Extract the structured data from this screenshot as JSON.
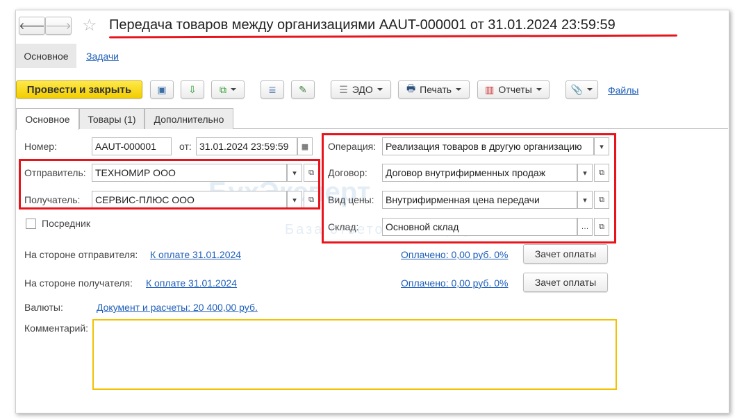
{
  "title": "Передача товаров между организациями AAUT-000001 от 31.01.2024 23:59:59",
  "nav_tabs": [
    "Основное",
    "Задачи"
  ],
  "toolbar": {
    "post_close": "Провести и закрыть",
    "edo": "ЭДО",
    "print": "Печать",
    "reports": "Отчеты",
    "files": "Файлы"
  },
  "tabs": [
    "Основное",
    "Товары (1)",
    "Дополнительно"
  ],
  "form": {
    "number_label": "Номер:",
    "number": "AAUT-000001",
    "from_label": "от:",
    "date": "31.01.2024 23:59:59",
    "sender_label": "Отправитель:",
    "sender": "ТЕХНОМИР ООО",
    "receiver_label": "Получатель:",
    "receiver": "СЕРВИС-ПЛЮС ООО",
    "intermediary": "Посредник",
    "operation_label": "Операция:",
    "operation": "Реализация товаров в другую организацию",
    "contract_label": "Договор:",
    "contract": "Договор внутрифирменных продаж",
    "price_label": "Вид цены:",
    "price": "Внутрифирменная цена передачи",
    "warehouse_label": "Склад:",
    "warehouse": "Основной склад",
    "sender_side_label": "На стороне отправителя:",
    "sender_side_link": "К оплате 31.01.2024",
    "sender_paid": "Оплачено: 0,00 руб. 0%",
    "receiver_side_label": "На стороне получателя:",
    "receiver_side_link": "К оплате 31.01.2024",
    "receiver_paid": "Оплачено: 0,00 руб. 0%",
    "offset_button": "Зачет оплаты",
    "currency_label": "Валюты:",
    "currency_link": "Документ и расчеты: 20 400,00 руб.",
    "comment_label": "Комментарий:",
    "comment": ""
  },
  "watermark": {
    "brand": "БухЭксперт",
    "tagline": "База ответов эксперту в 1С"
  }
}
